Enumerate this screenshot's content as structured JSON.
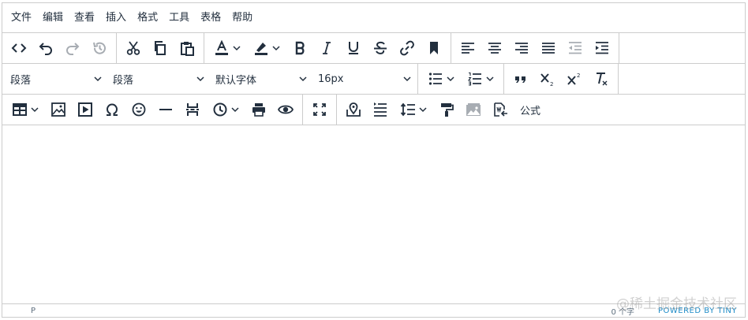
{
  "menubar": {
    "items": [
      "文件",
      "编辑",
      "查看",
      "插入",
      "格式",
      "工具",
      "表格",
      "帮助"
    ]
  },
  "toolbar": {
    "block_format": "段落",
    "paragraph_style": "段落",
    "font_family": "默认字体",
    "font_size": "16px",
    "formula_label": "公式"
  },
  "statusbar": {
    "path": "P",
    "word_count": "0 个字",
    "powered_by": "POWERED BY TINY"
  },
  "watermark": "@稀土掘金技术社区",
  "colors": {
    "border": "#cccccc",
    "icon": "#222f3e",
    "disabled_icon": "#a8adb3",
    "link": "#1d8bc7"
  }
}
